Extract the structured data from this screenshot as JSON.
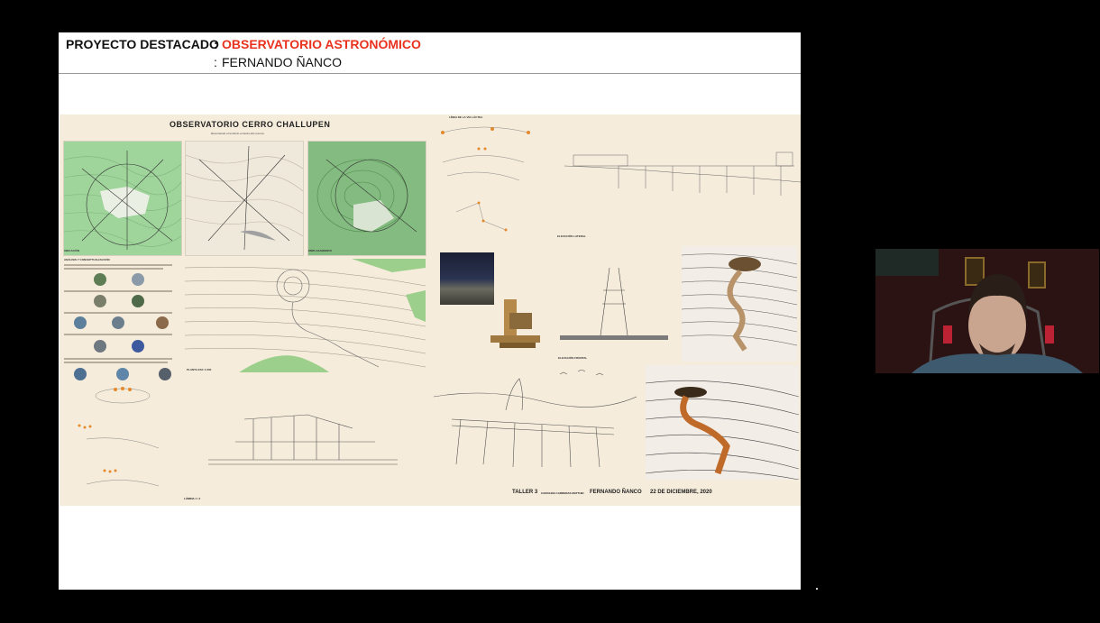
{
  "slide": {
    "project_label": "PROYECTO DESTACADO",
    "colon": ":",
    "title": "OBSERVATORIO ASTRONÓMICO",
    "author": "FERNANDO ÑANCO"
  },
  "poster": {
    "title": "OBSERVATORIO CERRO CHALLUPEN",
    "subtitle": "Recorriendo el territorio a través del cosmos",
    "footer": {
      "course": "TALLER 3",
      "coordinator": "CAROLINA CARRERAS MATTHEI",
      "author": "FERNANDO ÑANCO",
      "date": "22 DE DICIEMBRE, 2020",
      "sheet": "LÁMINA 1 / 4"
    },
    "labels": {
      "analysis": "ANÁLISIS Y CONCEPTUALIZACIÓN",
      "plan": "PLANTA ESC 1:200",
      "lateral": "ELEVACIÓN LATERAL",
      "frontal": "ELEVACIÓN FRONTAL",
      "ubicacion": "UBICACIÓN",
      "emplazamiento": "EMPLAZAMIENTO",
      "linea": "LÍNEA DE LA VÍA LÁCTEA"
    }
  },
  "colors": {
    "accent_title": "#e8321e",
    "background": "#000000",
    "poster_bg": "#f6ecdb"
  },
  "video": {
    "participant": "camera-feed"
  }
}
